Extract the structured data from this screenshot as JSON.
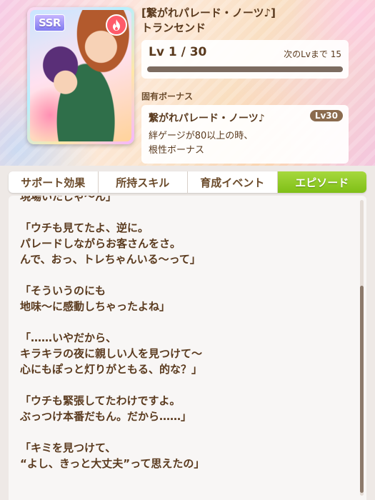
{
  "card": {
    "rarity": "SSR",
    "type_icon": "fire-icon",
    "title_line1": "[繋がれパレード・ノーツ♪]",
    "title_line2": "トランセンド",
    "level_text": "Lv 1 / 30",
    "next_level_text": "次のLvまで 15",
    "level_progress": 0.0
  },
  "bonus": {
    "label": "固有ボーナス",
    "name": "繋がれパレード・ノーツ♪",
    "level": "Lv30",
    "desc_line1": "絆ゲージが80以上の時、",
    "desc_line2": "根性ボーナス"
  },
  "tabs": [
    {
      "label": "サポート効果",
      "active": false
    },
    {
      "label": "所持スキル",
      "active": false
    },
    {
      "label": "育成イベント",
      "active": false
    },
    {
      "label": "エピソード",
      "active": true
    }
  ],
  "episode": {
    "paragraphs": [
      [
        "現場いたじゃ～ん」"
      ],
      [
        "「ウチも見てたよ、逆に。",
        "パレードしながらお客さんをさ。",
        "んで、おっ、トレちゃんいる～って」"
      ],
      [
        "「そういうのにも",
        "地味～に感動しちゃったよね」"
      ],
      [
        "「……いやだから、",
        "キラキラの夜に親しい人を見つけて～",
        "心にもぽっと灯りがともる、的な？」"
      ],
      [
        "「ウチも緊張してたわけですよ。",
        "ぶっつけ本番だもん。だから……」"
      ],
      [
        "「キミを見つけて、",
        "“よし、きっと大丈夫”って思えたの」"
      ]
    ]
  },
  "colors": {
    "text_brown": "#5a3a1e",
    "tab_active_green": "#8cc71f",
    "level_bar_bg": "#7c6b60",
    "bonus_lv_badge": "#8b6b4e",
    "fire_badge": "#ff5b6a"
  }
}
